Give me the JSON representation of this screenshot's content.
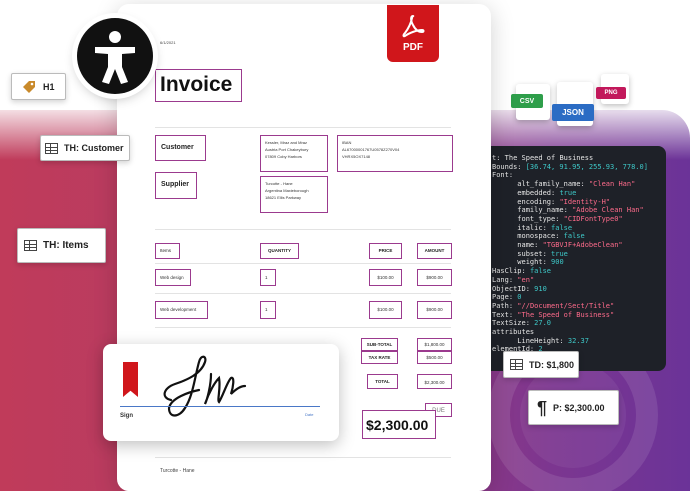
{
  "tags": {
    "h1": "H1",
    "th_customer": "TH: Customer",
    "th_items": "TH: Items",
    "td_1800": "TD: $1,800",
    "p_2300": "P: $2,300.00"
  },
  "badges": {
    "pdf": "PDF",
    "csv": "CSV",
    "json": "JSON",
    "png": "PNG"
  },
  "invoice": {
    "date": "6/1/2021",
    "title": "Invoice",
    "customer_label": "Customer",
    "supplier_label": "Supplier",
    "customer_address": [
      "Kessler, Mraz and Mraz",
      "Austria Port Chakeybury",
      "07809 Coby Harbors"
    ],
    "iban": [
      "IBAN",
      "AL67000001767U0578Z270V04",
      "VHRX5OX7148"
    ],
    "supplier_address": [
      "Turcotte - Hane",
      "Argentina Maxieborough",
      "18621 Ellis Parkway"
    ],
    "table_headers": {
      "items": "Items",
      "quantity": "QUANTITY",
      "price": "PRICE",
      "amount": "AMOUNT"
    },
    "rows": [
      {
        "item": "Web design",
        "qty": "1",
        "price": "$100.00",
        "amount": "$900.00"
      },
      {
        "item": "Web development",
        "qty": "1",
        "price": "$100.00",
        "amount": "$900.00"
      }
    ],
    "subtotal_label": "SUB-TOTAL",
    "subtotal_value": "$1,800.00",
    "tax_label": "TAX RATE",
    "tax_value": "$500.00",
    "total_label": "TOTAL",
    "total_value": "$2,300.00",
    "due_label": "DUE",
    "due_value": "$2,300.00",
    "footer": "Turcotte - Hane"
  },
  "sign": {
    "label": "Sign",
    "date": "Date"
  },
  "code_lines": [
    {
      "k": "t: ",
      "v": "The Speed of Business",
      "c": "k"
    },
    {
      "k": "Bounds: ",
      "v": "[36.74, 91.95, 255.93, 778.0]",
      "c": "n"
    },
    {
      "k": "Font:",
      "v": "",
      "c": "k"
    },
    {
      "k": "      alt_family_name: ",
      "v": "\"Clean Han\"",
      "c": "s"
    },
    {
      "k": "      embedded: ",
      "v": "true",
      "c": "n"
    },
    {
      "k": "      encoding: ",
      "v": "\"Identity-H\"",
      "c": "s"
    },
    {
      "k": "      family_name: ",
      "v": "\"Adobe Clean Han\"",
      "c": "s"
    },
    {
      "k": "      font_type: ",
      "v": "\"CIDFontType0\"",
      "c": "s"
    },
    {
      "k": "      italic: ",
      "v": "false",
      "c": "n"
    },
    {
      "k": "      monospace: ",
      "v": "false",
      "c": "n"
    },
    {
      "k": "      name: ",
      "v": "\"TGBVJF+AdobeClean\"",
      "c": "s"
    },
    {
      "k": "      subset: ",
      "v": "true",
      "c": "n"
    },
    {
      "k": "      weight: ",
      "v": "900",
      "c": "n"
    },
    {
      "k": "HasClip: ",
      "v": "false",
      "c": "n"
    },
    {
      "k": "Lang: ",
      "v": "\"en\"",
      "c": "s"
    },
    {
      "k": "ObjectID: ",
      "v": "910",
      "c": "n"
    },
    {
      "k": "Page: ",
      "v": "0",
      "c": "n"
    },
    {
      "k": "Path: ",
      "v": "\"//Document/Sect/Title\"",
      "c": "s"
    },
    {
      "k": "Text: ",
      "v": "\"The Speed of Business\"",
      "c": "s"
    },
    {
      "k": "TextSize: ",
      "v": "27.0",
      "c": "n"
    },
    {
      "k": "attributes",
      "v": "",
      "c": "k"
    },
    {
      "k": "      LineHeight: ",
      "v": "32.37",
      "c": "n"
    },
    {
      "k": "elementId: ",
      "v": "2",
      "c": "n"
    }
  ],
  "colors": {
    "accent": "#9b3a8e",
    "pdf_red": "#d0161b",
    "csv_green": "#2e9e4a",
    "json_blue": "#2b6cc4",
    "png_pink": "#c2185b"
  }
}
